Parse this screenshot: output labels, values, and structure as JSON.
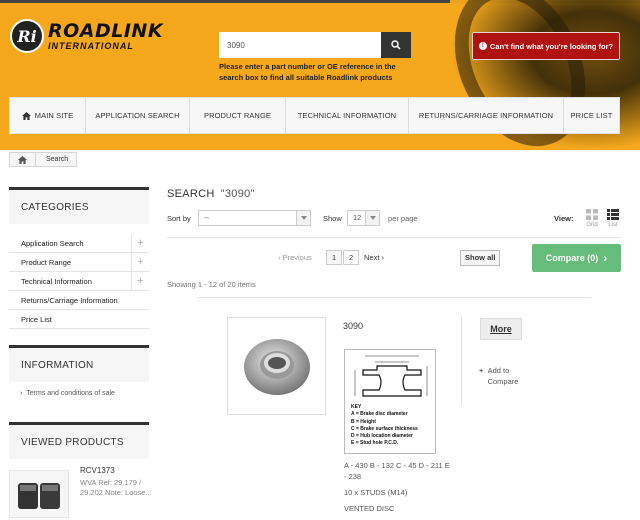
{
  "header": {
    "logo_mark": "Ri",
    "logo_word1": "ROADLINK",
    "logo_word2": "INTERNATIONAL",
    "search_value": "3090",
    "search_hint": "Please enter a part number or OE reference in the search box to find all suitable Roadlink products",
    "cant_find": "Can't find what you're looking for?",
    "search_icon": "search-icon"
  },
  "nav": {
    "items": [
      {
        "label": "MAIN SITE"
      },
      {
        "label": "APPLICATION SEARCH"
      },
      {
        "label": "PRODUCT RANGE"
      },
      {
        "label": "TECHNICAL INFORMATION"
      },
      {
        "label": "RETURNS/CARRIAGE INFORMATION"
      },
      {
        "label": "PRICE LIST"
      }
    ]
  },
  "breadcrumb": {
    "current": "Search"
  },
  "sidebar": {
    "categories_title": "CATEGORIES",
    "categories": [
      {
        "label": "Application Search",
        "expandable": true
      },
      {
        "label": "Product Range",
        "expandable": true
      },
      {
        "label": "Technical Information",
        "expandable": true
      },
      {
        "label": "Returns/Carriage Information",
        "expandable": false
      },
      {
        "label": "Price List",
        "expandable": false
      }
    ],
    "information_title": "INFORMATION",
    "information_link": "Terms and conditions of sale",
    "viewed_title": "VIEWED PRODUCTS",
    "viewed_item": {
      "name": "RCV1373",
      "desc": "WVA Ref: 29.179 / 29.202 Note: Loose..."
    }
  },
  "main": {
    "title": "SEARCH",
    "query": "\"3090\"",
    "sort_label": "Sort by",
    "sort_value": "--",
    "show_label": "Show",
    "show_value": "12",
    "per_page": "per page",
    "view_label": "View:",
    "grid_label": "Grid",
    "list_label": "List",
    "prev_label": "Previous",
    "next_label": "Next",
    "pages": [
      "1",
      "2"
    ],
    "show_all": "Show all",
    "compare": "Compare (0)",
    "showing": "Showing 1 - 12 of 20 items"
  },
  "product": {
    "name": "3090",
    "key_title": "KEY",
    "key_lines": [
      "A = Brake disc diameter",
      "B = Height",
      "C = Brake surface thickness",
      "D = Hub location diameter",
      "E = Stud hole P.C.D."
    ],
    "desc_lines": [
      "A - 430 B - 132 C - 45 D - 211 E - 238",
      "10 x STUDS (M14)",
      "VENTED DISC"
    ],
    "more": "More",
    "add_compare": "Add to Compare"
  }
}
